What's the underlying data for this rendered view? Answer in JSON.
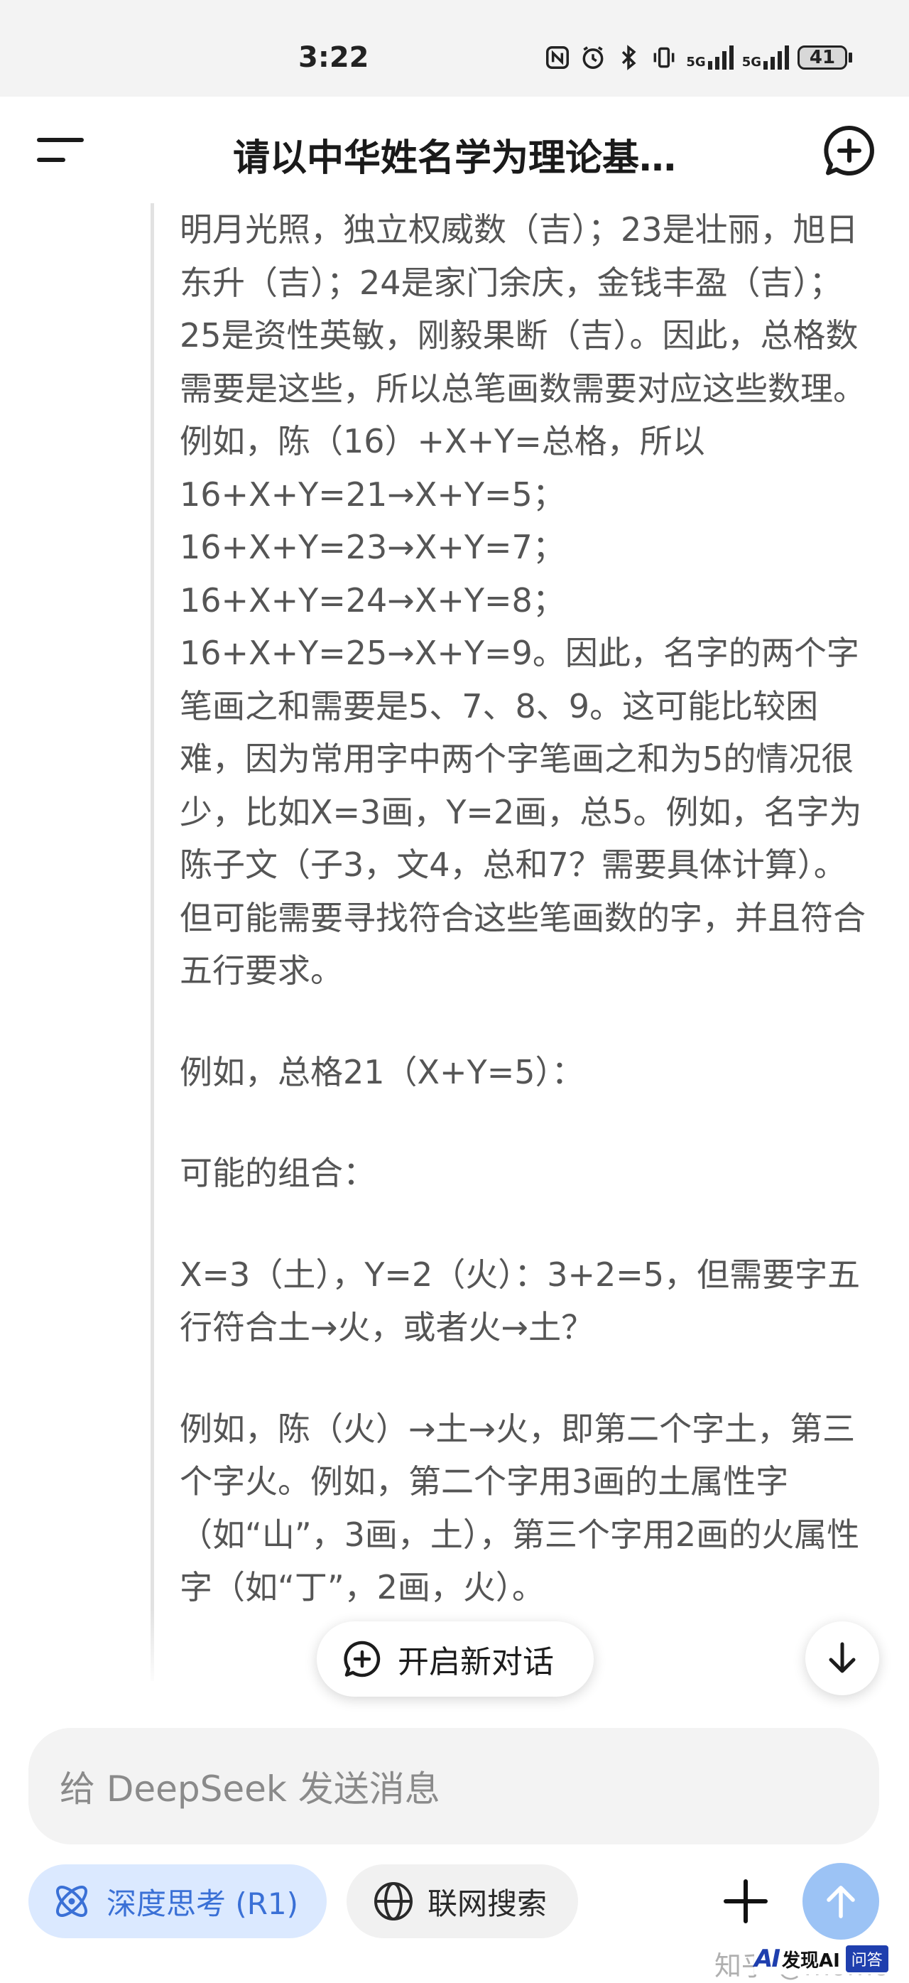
{
  "status_bar": {
    "time": "3:22",
    "network_label_1": "5G",
    "network_label_2": "5G",
    "battery": "41"
  },
  "header": {
    "title": "请以中华姓名学为理论基…"
  },
  "thinking": {
    "paragraphs": [
      "明月光照，独立权威数（吉）；23是壮丽，旭日东升（吉）；24是家门余庆，金钱丰盈（吉）；25是资性英敏，刚毅果断（吉）。因此，总格数需要是这些，所以总笔画数需要对应这些数理。例如，陈（16）+X+Y=总格，所以",
      "16+X+Y=21→X+Y=5；",
      "16+X+Y=23→X+Y=7；",
      "16+X+Y=24→X+Y=8；",
      "16+X+Y=25→X+Y=9。因此，名字的两个字笔画之和需要是5、7、8、9。这可能比较困难，因为常用字中两个字笔画之和为5的情况很少，比如X=3画，Y=2画，总5。例如，名字为陈子文（子3，文4，总和7？需要具体计算）。但可能需要寻找符合这些笔画数的字，并且符合五行要求。",
      "例如，总格21（X+Y=5）：",
      "可能的组合：",
      "X=3（土），Y=2（火）：3+2=5，但需要字五行符合土→火，或者火→土？",
      "例如，陈（火）→土→火，即第二个字土，第三个字火。例如，第二个字用3画的土属性字（如“山”，3画，土），第三个字用2画的火属性字（如“丁”，2画，火）。"
    ]
  },
  "floating": {
    "new_chat_label": "开启新对话"
  },
  "input": {
    "placeholder": "给 DeepSeek 发送消息"
  },
  "toolbar": {
    "deep_think_label": "深度思考 (R1)",
    "web_search_label": "联网搜索"
  },
  "watermark": {
    "zhihu": "知乎 @momo",
    "brand": "发现AI",
    "qa": "问答"
  },
  "colors": {
    "accent_blue": "#3a70d6",
    "deep_think_bg": "#dbe9ff",
    "send_button_bg": "#9cc3f5"
  },
  "icons": {
    "menu": "menu-icon",
    "new_chat": "new-chat-icon",
    "scroll_down": "arrow-down-icon",
    "deep_think": "atom-icon",
    "web_search": "globe-icon",
    "attach": "plus-icon",
    "send": "arrow-up-icon"
  }
}
